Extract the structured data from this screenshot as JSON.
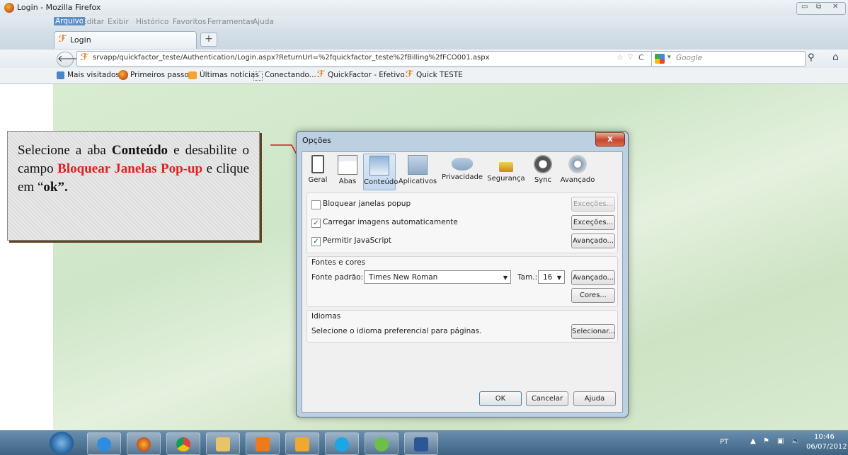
{
  "window": {
    "title": "Login - Mozilla Firefox"
  },
  "menu": [
    "Arquivo",
    "Editar",
    "Exibir",
    "Histórico",
    "Favoritos",
    "Ferramentas",
    "Ajuda"
  ],
  "tab": {
    "label": "Login",
    "new_tab": "+"
  },
  "nav": {
    "url": "srvapp/quickfactor_teste/Authentication/Login.aspx?ReturnUrl=%2fquickfactor_teste%2fBilling%2fFCO001.aspx",
    "search_placeholder": "Google"
  },
  "bookmarks": [
    "Mais visitados",
    "Primeiros passos",
    "Últimas notícias",
    "Conectando...",
    "QuickFactor - Efetivo",
    "Quick TESTE"
  ],
  "callout": {
    "t1": "Selecione a aba ",
    "t2": "Conteúdo",
    "t3": " e desabilite o campo ",
    "t4": "Bloquear Janelas Pop-up",
    "t5": " e clique em “",
    "t6": "ok”.",
    "t7": ""
  },
  "dialog": {
    "title": "Opções",
    "close": "x",
    "tabs": [
      "Geral",
      "Abas",
      "Conteúdo",
      "Aplicativos",
      "Privacidade",
      "Segurança",
      "Sync",
      "Avançado"
    ],
    "content": {
      "popup_label": "Bloquear janelas popup",
      "popup_checked": false,
      "images_label": "Carregar imagens automaticamente",
      "images_checked": true,
      "js_label": "Permitir JavaScript",
      "js_checked": true,
      "exceptions1": "Exceções...",
      "exceptions2": "Exceções...",
      "advanced1": "Avançado...",
      "fonts_group": "Fontes e cores",
      "default_font_label": "Fonte padrão:",
      "default_font": "Times New Roman",
      "size_label": "Tam.:",
      "size": "16",
      "advanced2": "Avançado...",
      "colors": "Cores...",
      "lang_group": "Idiomas",
      "lang_text": "Selecione o idioma preferencial para páginas.",
      "select": "Selecionar..."
    },
    "buttons": {
      "ok": "OK",
      "cancel": "Cancelar",
      "help": "Ajuda"
    }
  },
  "taskbar": {
    "lang": "PT",
    "time": "10:46",
    "date": "06/07/2012"
  }
}
